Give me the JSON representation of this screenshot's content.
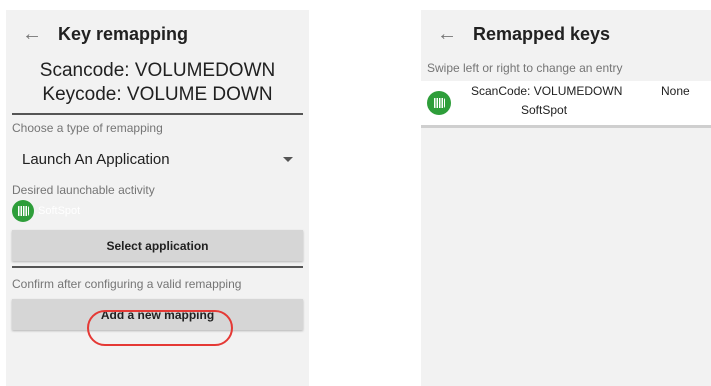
{
  "left": {
    "title": "Key remapping",
    "back_icon": "arrow-left",
    "scancode": "Scancode: VOLUMEDOWN",
    "keycode": "Keycode: VOLUME DOWN",
    "type_label": "Choose a type of remapping",
    "type_value": "Launch An Application",
    "activity_label": "Desired launchable activity",
    "app_name": "SoftSpot",
    "select_button": "Select application",
    "confirm_label": "Confirm after configuring a valid remapping",
    "add_button": "Add a new mapping",
    "highlight_color": "#e53935"
  },
  "right": {
    "title": "Remapped keys",
    "back_icon": "arrow-left",
    "hint": "Swipe left or right to change an entry",
    "entries": [
      {
        "scancode": "ScanCode: VOLUMEDOWN",
        "app": "SoftSpot",
        "value": "None"
      }
    ]
  },
  "colors": {
    "icon_green": "#2e9e3a",
    "screen_bg": "#f2f2f2",
    "button_bg": "#d6d6d6"
  }
}
